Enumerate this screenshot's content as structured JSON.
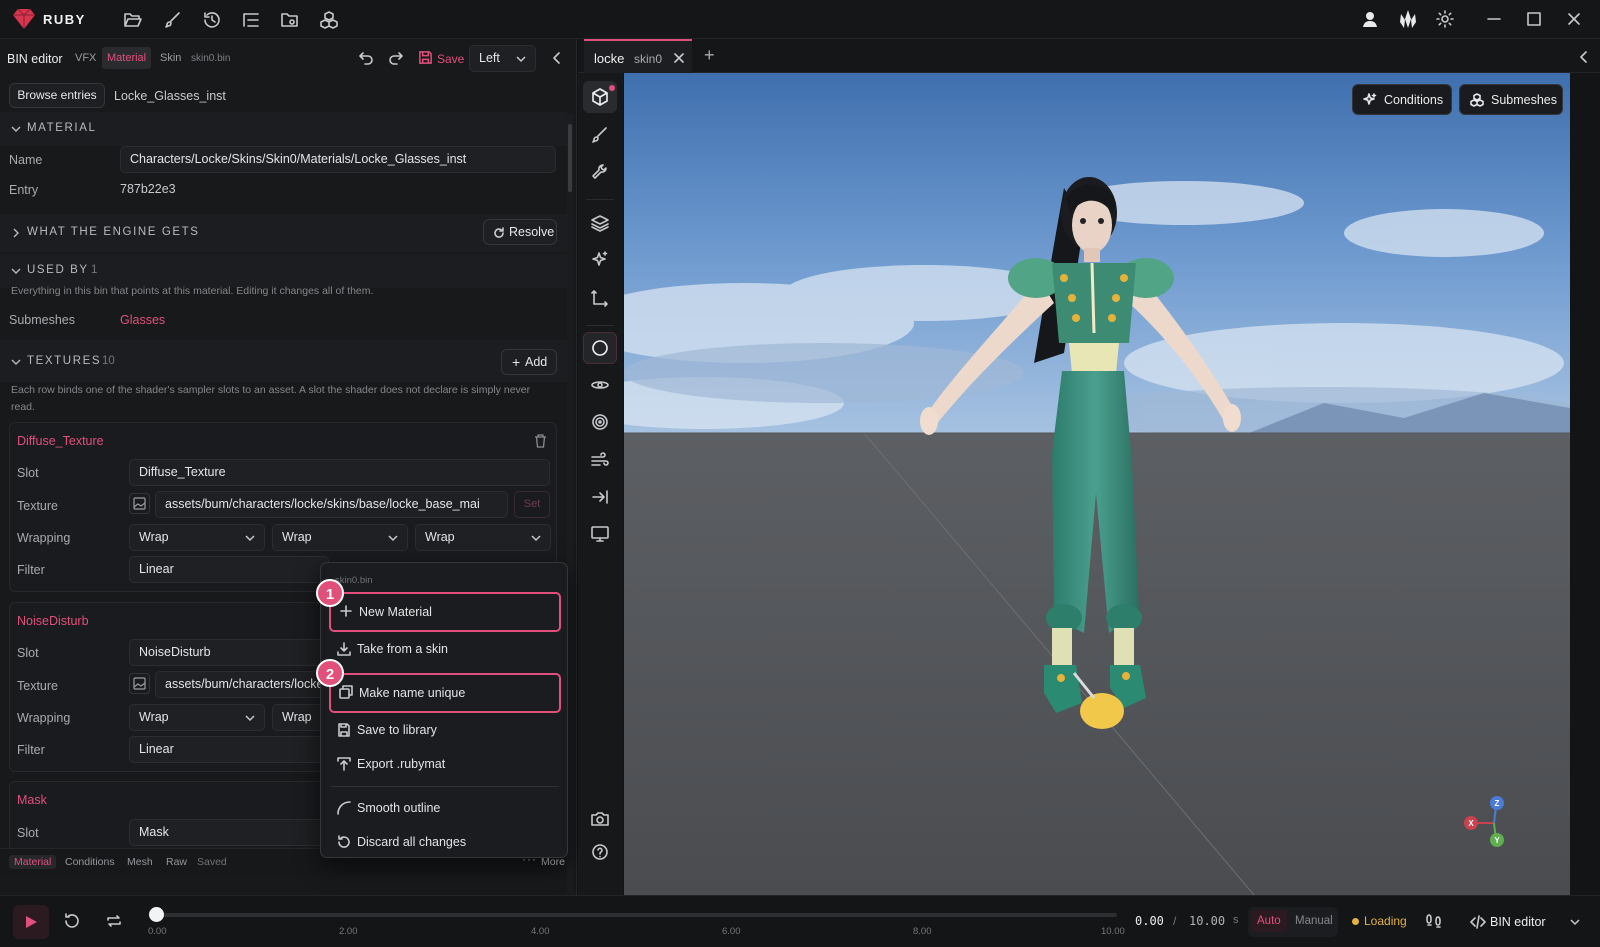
{
  "app": {
    "name": "RUBY"
  },
  "editor": {
    "title": "BIN editor",
    "tabs": [
      "VFX",
      "Material",
      "Skin"
    ],
    "file": "skin0.bin",
    "save_label": "Save",
    "side_select": "Left",
    "browse_label": "Browse entries",
    "entry_name": "Locke_Glasses_inst"
  },
  "material": {
    "header": "MATERIAL",
    "name_label": "Name",
    "name_value": "Characters/Locke/Skins/Skin0/Materials/Locke_Glasses_inst",
    "entry_label": "Entry",
    "entry_value": "787b22e3"
  },
  "engine": {
    "header": "WHAT THE ENGINE GETS",
    "resolve_label": "Resolve"
  },
  "used_by": {
    "header": "USED BY",
    "count": "1",
    "description": "Everything in this bin that points at this material. Editing it changes all of them.",
    "submeshes_label": "Submeshes",
    "submeshes_value": "Glasses"
  },
  "textures": {
    "header": "TEXTURES",
    "count": "10",
    "add_label": "Add",
    "description_line1": "Each row binds one of the shader's sampler slots to an asset. A slot the shader does not declare is simply never",
    "description_line2": "read.",
    "labels": {
      "slot": "Slot",
      "texture": "Texture",
      "wrapping": "Wrapping",
      "filter": "Filter",
      "set": "Set"
    },
    "items": [
      {
        "name": "Diffuse_Texture",
        "slot": "Diffuse_Texture",
        "texture": "assets/bum/characters/locke/skins/base/locke_base_mai",
        "wrap": [
          "Wrap",
          "Wrap",
          "Wrap"
        ],
        "filter": "Linear"
      },
      {
        "name": "NoiseDisturb",
        "slot": "NoiseDisturb",
        "texture": "assets/bum/characters/locke",
        "wrap": [
          "Wrap",
          "Wrap"
        ],
        "filter": "Linear"
      },
      {
        "name": "Mask",
        "slot": "Mask"
      }
    ]
  },
  "bottom_tabs": [
    "Material",
    "Conditions",
    "Mesh",
    "Raw",
    "Saved"
  ],
  "more_label": "More",
  "menu": {
    "header": "skin0.bin",
    "items": [
      "New Material",
      "Take from a skin",
      "Make name unique",
      "Save to library",
      "Export .rubymat",
      "Smooth outline",
      "Discard all changes"
    ],
    "badges": [
      "1",
      "2"
    ]
  },
  "viewer_tab": {
    "name": "locke",
    "sub": "skin0"
  },
  "viewport": {
    "conditions_label": "Conditions",
    "submeshes_label": "Submeshes",
    "axes": [
      "Z",
      "X",
      "Y"
    ]
  },
  "timeline": {
    "ticks": [
      "0.00",
      "2.00",
      "4.00",
      "6.00",
      "8.00",
      "10.00"
    ],
    "current": "0.00",
    "separator": "/",
    "total": "10.00",
    "unit": "s",
    "progress": 0,
    "auto_label": "Auto",
    "manual_label": "Manual",
    "status": "Loading",
    "mode": "BIN editor"
  },
  "colors": {
    "accent": "#e0507a",
    "status": "#e3b341"
  }
}
